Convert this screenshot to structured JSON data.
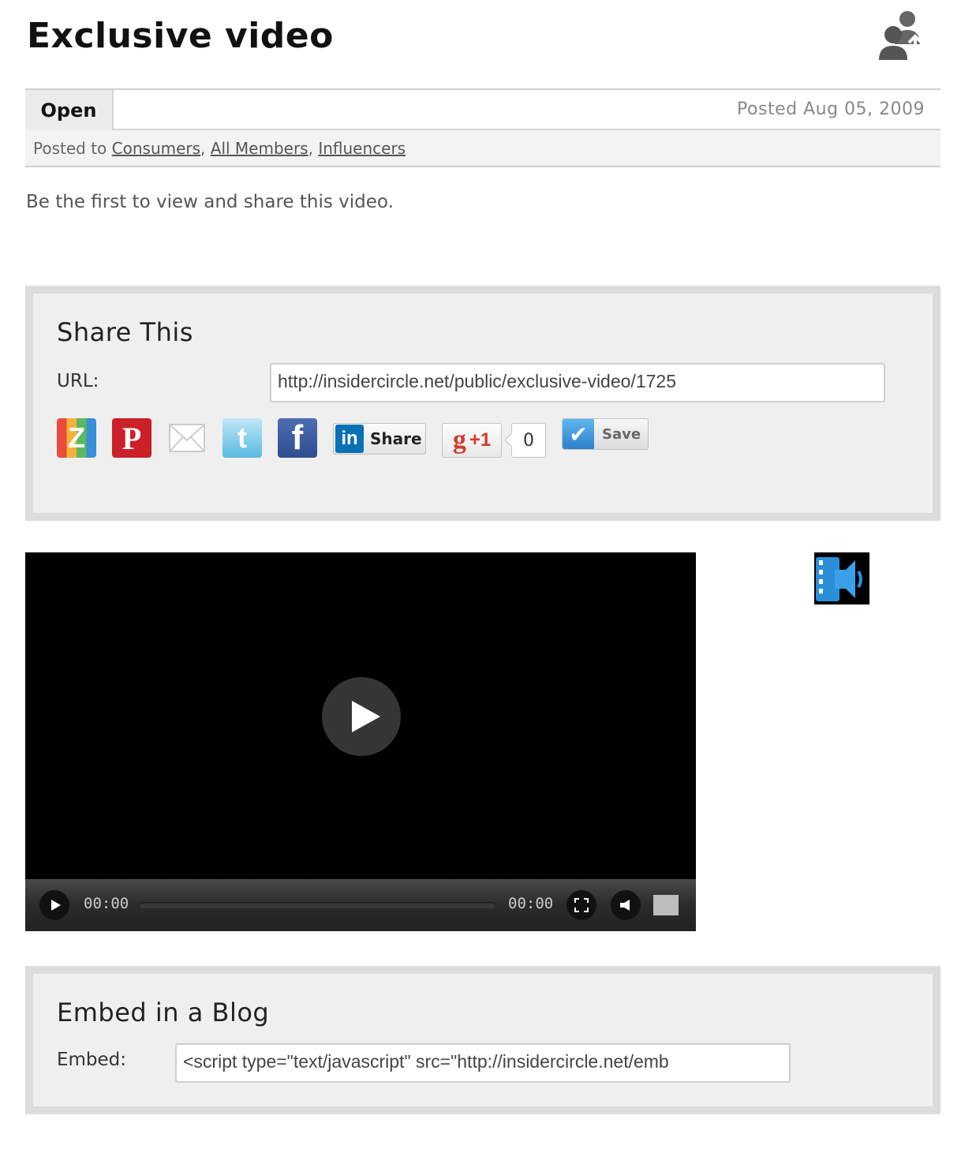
{
  "page": {
    "title": "Exclusive video",
    "header_icons": [
      "video-speaker-icon",
      "people-share-icon"
    ]
  },
  "status": {
    "label": "Open",
    "posted_date": "Posted Aug 05, 2009",
    "posted_to_prefix": "Posted to",
    "groups": [
      "Consumers",
      "All Members",
      "Influencers"
    ]
  },
  "intro_text": "Be the first to view and share this video.",
  "share": {
    "title": "Share This",
    "url_label": "URL:",
    "url_value": "http://insidercircle.net/public/exclusive-video/1725",
    "buttons": {
      "zootool": "Z",
      "pinterest": "P",
      "email": "email-icon",
      "twitter": "t",
      "facebook": "f",
      "linkedin_logo": "in",
      "linkedin_label": "Share",
      "gplus_g": "g",
      "gplus_label": "+1",
      "gplus_count": "0",
      "save_label": "Save"
    }
  },
  "video": {
    "current_time": "00:00",
    "duration": "00:00",
    "progress": 0
  },
  "embed": {
    "title": "Embed in a Blog",
    "label": "Embed:",
    "code": "<script type=\"text/javascript\" src=\"http://insidercircle.net/emb"
  },
  "colors": {
    "pinterest": "#cb2027",
    "facebook": "#3b5998",
    "linkedin": "#0a71b5",
    "gplus": "#d43a2c",
    "accent_blue": "#2a8fd8"
  }
}
